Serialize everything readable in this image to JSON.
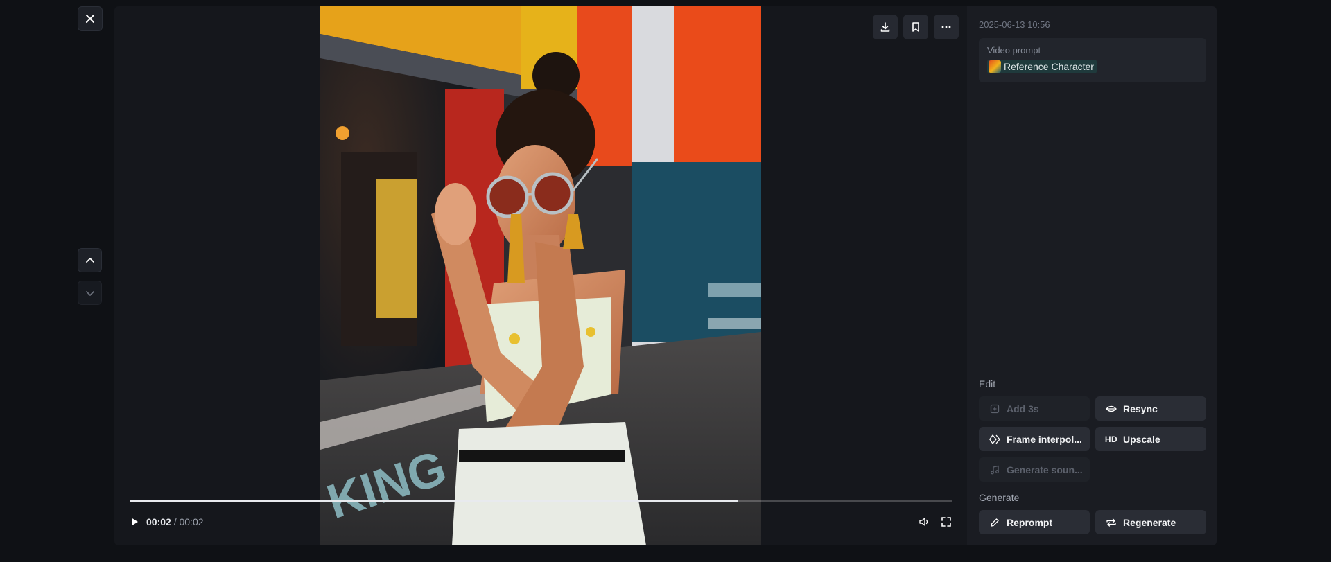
{
  "icons": {
    "close": "close-icon",
    "nav_up": "chevron-up-icon",
    "nav_down": "chevron-down-icon",
    "download": "download-icon",
    "bookmark": "bookmark-icon",
    "more": "more-icon",
    "play": "play-icon",
    "volume": "volume-icon",
    "fullscreen": "fullscreen-icon"
  },
  "player": {
    "current_time": "00:02",
    "separator": " / ",
    "duration": "00:02",
    "progress": 0.74
  },
  "sidebar": {
    "timestamp": "2025-06-13 10:56",
    "prompt_label": "Video prompt",
    "reference_label": "Reference Character",
    "edit_title": "Edit",
    "generate_title": "Generate",
    "actions": {
      "add3s": "Add 3s",
      "resync": "Resync",
      "frame_interpolation": "Frame interpol...",
      "upscale": "Upscale",
      "upscale_badge": "HD",
      "generate_sound": "Generate soun...",
      "reprompt": "Reprompt",
      "regenerate": "Regenerate"
    }
  },
  "colors": {
    "background": "#0f1115",
    "panel": "#1a1c22",
    "button": "#2a2d35",
    "chip": "#1f3a3c"
  }
}
